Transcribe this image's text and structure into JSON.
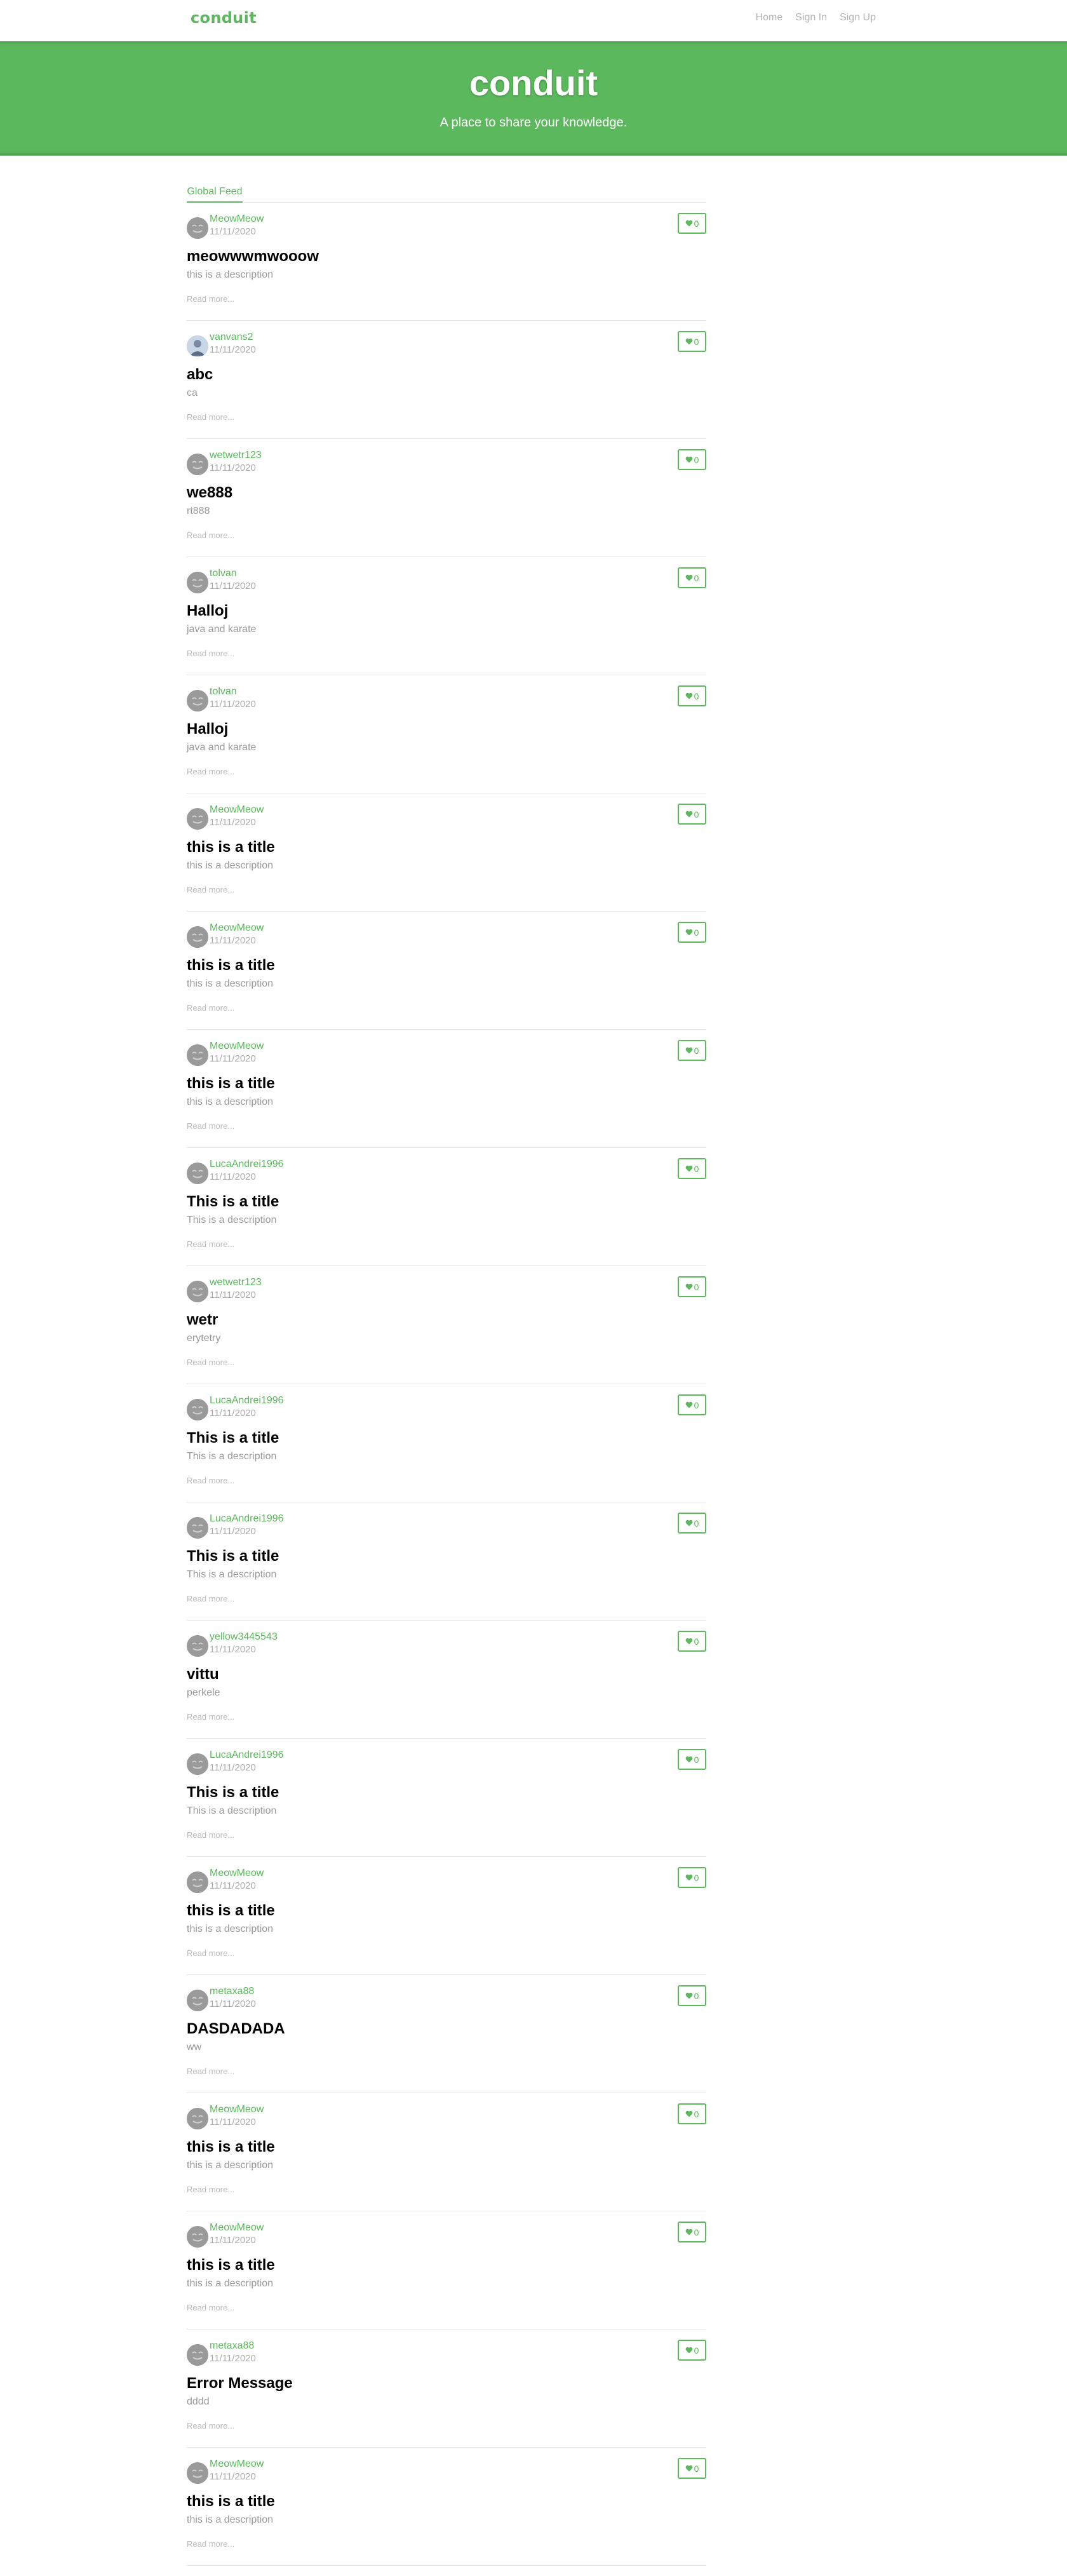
{
  "nav": {
    "brand": "conduit",
    "links": [
      "Home",
      "Sign In",
      "Sign Up"
    ]
  },
  "banner": {
    "title": "conduit",
    "subtitle": "A place to share your knowledge."
  },
  "feed": {
    "tab": "Global Feed",
    "read_more": "Read more...",
    "articles": [
      {
        "author": "MeowMeow",
        "date": "11/11/2020",
        "title": "meowwwmwooow",
        "description": "this is a description",
        "favorites": "0",
        "avatar": "smiley"
      },
      {
        "author": "vanvans2",
        "date": "11/11/2020",
        "title": "abc",
        "description": "ca",
        "favorites": "0",
        "avatar": "photo"
      },
      {
        "author": "wetwetr123",
        "date": "11/11/2020",
        "title": "we888",
        "description": "rt888",
        "favorites": "0",
        "avatar": "smiley"
      },
      {
        "author": "tolvan",
        "date": "11/11/2020",
        "title": "Halloj",
        "description": "java and karate",
        "favorites": "0",
        "avatar": "smiley"
      },
      {
        "author": "tolvan",
        "date": "11/11/2020",
        "title": "Halloj",
        "description": "java and karate",
        "favorites": "0",
        "avatar": "smiley"
      },
      {
        "author": "MeowMeow",
        "date": "11/11/2020",
        "title": "this is a title",
        "description": "this is a description",
        "favorites": "0",
        "avatar": "smiley"
      },
      {
        "author": "MeowMeow",
        "date": "11/11/2020",
        "title": "this is a title",
        "description": "this is a description",
        "favorites": "0",
        "avatar": "smiley"
      },
      {
        "author": "MeowMeow",
        "date": "11/11/2020",
        "title": "this is a title",
        "description": "this is a description",
        "favorites": "0",
        "avatar": "smiley"
      },
      {
        "author": "LucaAndrei1996",
        "date": "11/11/2020",
        "title": "This is a title",
        "description": "This is a description",
        "favorites": "0",
        "avatar": "smiley"
      },
      {
        "author": "wetwetr123",
        "date": "11/11/2020",
        "title": "wetr",
        "description": "erytetry",
        "favorites": "0",
        "avatar": "smiley"
      },
      {
        "author": "LucaAndrei1996",
        "date": "11/11/2020",
        "title": "This is a title",
        "description": "This is a description",
        "favorites": "0",
        "avatar": "smiley"
      },
      {
        "author": "LucaAndrei1996",
        "date": "11/11/2020",
        "title": "This is a title",
        "description": "This is a description",
        "favorites": "0",
        "avatar": "smiley"
      },
      {
        "author": "yellow3445543",
        "date": "11/11/2020",
        "title": "vittu",
        "description": "perkele",
        "favorites": "0",
        "avatar": "smiley"
      },
      {
        "author": "LucaAndrei1996",
        "date": "11/11/2020",
        "title": "This is a title",
        "description": "This is a description",
        "favorites": "0",
        "avatar": "smiley"
      },
      {
        "author": "MeowMeow",
        "date": "11/11/2020",
        "title": "this is a title",
        "description": "this is a description",
        "favorites": "0",
        "avatar": "smiley"
      },
      {
        "author": "metaxa88",
        "date": "11/11/2020",
        "title": "DASDADADA",
        "description": "ww",
        "favorites": "0",
        "avatar": "smiley"
      },
      {
        "author": "MeowMeow",
        "date": "11/11/2020",
        "title": "this is a title",
        "description": "this is a description",
        "favorites": "0",
        "avatar": "smiley"
      },
      {
        "author": "MeowMeow",
        "date": "11/11/2020",
        "title": "this is a title",
        "description": "this is a description",
        "favorites": "0",
        "avatar": "smiley"
      },
      {
        "author": "metaxa88",
        "date": "11/11/2020",
        "title": "Error Message",
        "description": "dddd",
        "favorites": "0",
        "avatar": "smiley"
      },
      {
        "author": "MeowMeow",
        "date": "11/11/2020",
        "title": "this is a title",
        "description": "this is a description",
        "favorites": "0",
        "avatar": "smiley"
      }
    ]
  },
  "colors": {
    "brand": "#5cb85c",
    "muted": "#aaaaaa"
  }
}
